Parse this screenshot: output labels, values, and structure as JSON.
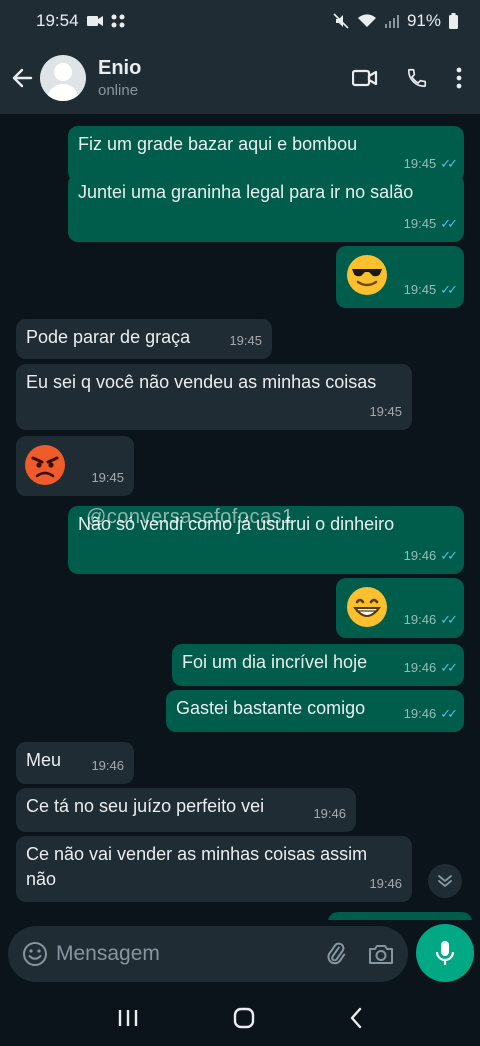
{
  "status_bar": {
    "time": "19:54",
    "battery": "91%"
  },
  "header": {
    "contact_name": "Enio",
    "contact_status": "online"
  },
  "messages": [
    {
      "text": "Fiz um grade bazar aqui e bombou",
      "time": "19:45",
      "direction": "out"
    },
    {
      "text": "Juntei uma graninha legal para ir no salão",
      "time": "19:45",
      "direction": "out"
    },
    {
      "emoji": "😎",
      "time": "19:45",
      "direction": "out"
    },
    {
      "text": "Pode parar de graça",
      "time": "19:45",
      "direction": "in"
    },
    {
      "text": "Eu sei q você não vendeu as minhas coisas",
      "time": "19:45",
      "direction": "in"
    },
    {
      "emoji": "😡",
      "time": "19:45",
      "direction": "in"
    },
    {
      "text": "Não só vendi como já usufrui o dinheiro",
      "time": "19:46",
      "direction": "out"
    },
    {
      "emoji": "😁",
      "time": "19:46",
      "direction": "out"
    },
    {
      "text": "Foi um dia incrível hoje",
      "time": "19:46",
      "direction": "out"
    },
    {
      "text": "Gastei bastante comigo",
      "time": "19:46",
      "direction": "out"
    },
    {
      "text": "Meu",
      "time": "19:46",
      "direction": "in"
    },
    {
      "text": "Ce tá no seu juízo perfeito vei",
      "time": "19:46",
      "direction": "in"
    },
    {
      "text": "Ce não vai vender as minhas coisas assim não",
      "time": "19:46",
      "direction": "in"
    }
  ],
  "watermark": "@conversasefofocas1",
  "input": {
    "placeholder": "Mensagem"
  },
  "colors": {
    "outgoing": "#005c4b",
    "incoming": "#202c33",
    "accent": "#00a884",
    "read_ticks": "#53bdeb"
  }
}
